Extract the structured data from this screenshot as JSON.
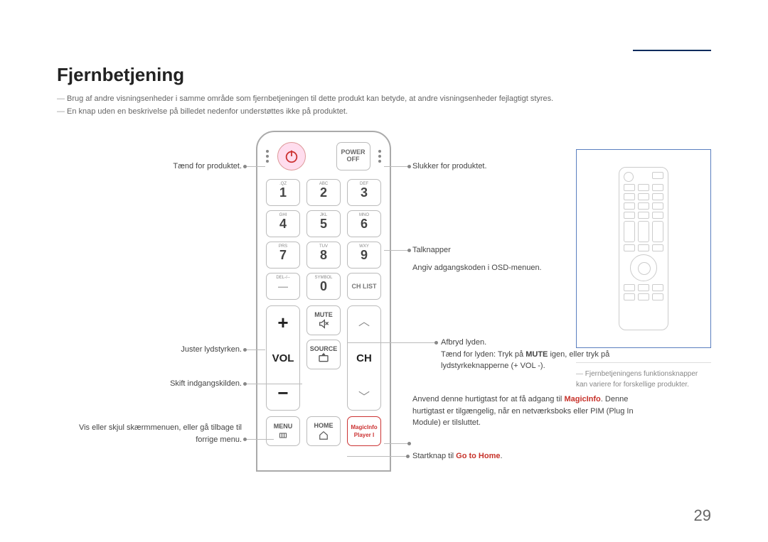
{
  "heading": "Fjernbetjening",
  "notes": [
    "Brug af andre visningsenheder i samme område som fjernbetjeningen til dette produkt kan betyde, at andre visningsenheder fejlagtigt styres.",
    "En knap uden en beskrivelse på billedet nedenfor understøttes ikke på produktet."
  ],
  "remote": {
    "power_off": {
      "l1": "POWER",
      "l2": "OFF"
    },
    "keypad": [
      {
        "t": ".QZ",
        "n": "1"
      },
      {
        "t": "ABC",
        "n": "2"
      },
      {
        "t": "DEF",
        "n": "3"
      },
      {
        "t": "GHI",
        "n": "4"
      },
      {
        "t": "JKL",
        "n": "5"
      },
      {
        "t": "MNO",
        "n": "6"
      },
      {
        "t": "PRS",
        "n": "7"
      },
      {
        "t": "TUV",
        "n": "8"
      },
      {
        "t": "WXY",
        "n": "9"
      },
      {
        "t": "DEL-/--",
        "n": ""
      },
      {
        "t": "SYMBOL",
        "n": "0"
      },
      {
        "t": "",
        "n": "CH LIST"
      }
    ],
    "vol": {
      "plus": "+",
      "label": "VOL",
      "minus": "−"
    },
    "ch": {
      "label": "CH"
    },
    "mute": "MUTE",
    "source": "SOURCE",
    "menu": "MENU",
    "home": "HOME",
    "magicinfo": {
      "l1": "MagicInfo",
      "l2": "Player I"
    }
  },
  "callouts": {
    "left": {
      "power_on": "Tænd for produktet.",
      "vol": "Juster lydstyrken.",
      "source": "Skift indgangskilden.",
      "menu": "Vis eller skjul skærmmenuen, eller gå tilbage til forrige menu."
    },
    "right": {
      "power_off": "Slukker for produktet.",
      "number_a": "Talknapper",
      "number_b": "Angiv adgangskoden i OSD-menuen.",
      "mute_a": "Afbryd lyden.",
      "mute_b_pre": "Tænd for lyden: Tryk på ",
      "mute_b_bold": "MUTE",
      "mute_b_post": " igen, eller tryk på lydstyrkeknapperne (+  VOL  -).",
      "magic_a": "Anvend denne hurtigtast for at få adgang til ",
      "magic_red": "MagicInfo",
      "magic_b": ". Denne hurtigtast er tilgængelig, når en netværksboks eller PIM (Plug In Module) er tilsluttet.",
      "home_pre": "Startknap til ",
      "home_red": "Go to Home",
      "home_post": "."
    }
  },
  "sidenote": "Fjernbetjeningens funktionsknapper kan variere for forskellige produkter.",
  "page_number": "29"
}
